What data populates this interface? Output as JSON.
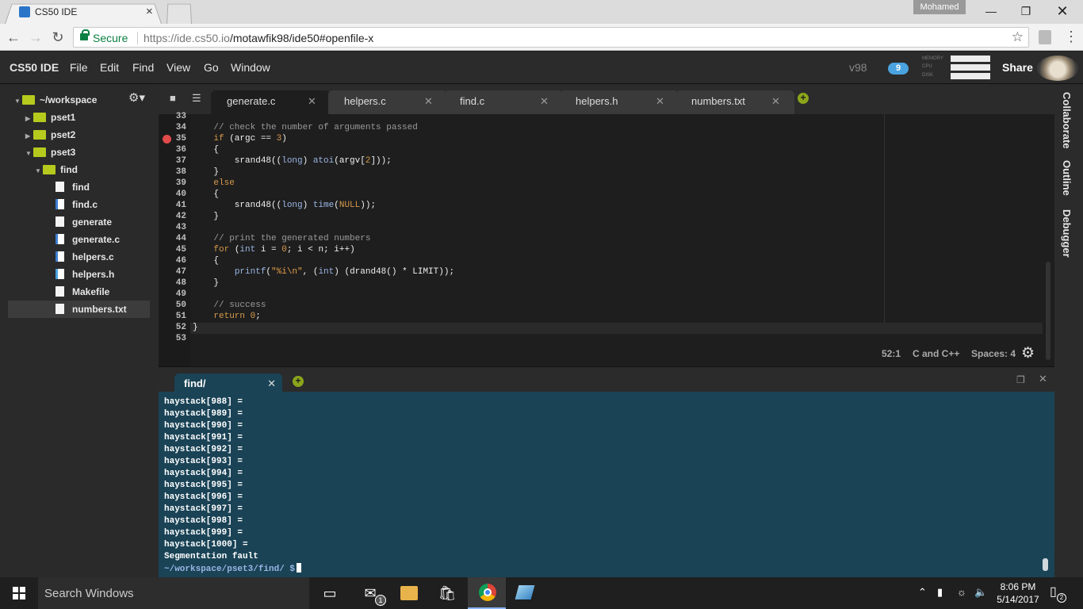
{
  "browser": {
    "tab_title": "CS50 IDE",
    "tab_close": "×",
    "user": "Mohamed",
    "secure_label": "Secure",
    "url_host": "https://ide.cs50.io",
    "url_path": "/motawfik98/ide50#openfile-x"
  },
  "ide": {
    "brand": "CS50 IDE",
    "menus": [
      "File",
      "Edit",
      "Find",
      "View",
      "Go",
      "Window"
    ],
    "version": "v98",
    "cloud_count": "9",
    "meters": [
      "MEMORY",
      "CPU",
      "DISK"
    ],
    "share": "Share"
  },
  "sidebar": {
    "root": "~/workspace",
    "items": [
      "pset1",
      "pset2",
      "pset3",
      "find",
      "find",
      "find.c",
      "generate",
      "generate.c",
      "helpers.c",
      "helpers.h",
      "Makefile",
      "numbers.txt"
    ]
  },
  "tabs": [
    "generate.c",
    "helpers.c",
    "find.c",
    "helpers.h",
    "numbers.txt"
  ],
  "right_panel": [
    "Collaborate",
    "Outline",
    "Debugger"
  ],
  "editor": {
    "status_pos": "52:1",
    "status_lang": "C and C++",
    "status_spaces": "Spaces: 4"
  },
  "terminal": {
    "tab": "find/",
    "lines": [
      "haystack[988] =",
      "haystack[989] =",
      "haystack[990] =",
      "haystack[991] =",
      "haystack[992] =",
      "haystack[993] =",
      "haystack[994] =",
      "haystack[995] =",
      "haystack[996] =",
      "haystack[997] =",
      "haystack[998] =",
      "haystack[999] =",
      "haystack[1000] =",
      "Segmentation fault"
    ],
    "prompt": "~/workspace/pset3/find/ $"
  },
  "taskbar": {
    "search": "Search Windows",
    "mail_badge": "1",
    "time": "8:06 PM",
    "date": "5/14/2017",
    "notif_count": "2"
  }
}
